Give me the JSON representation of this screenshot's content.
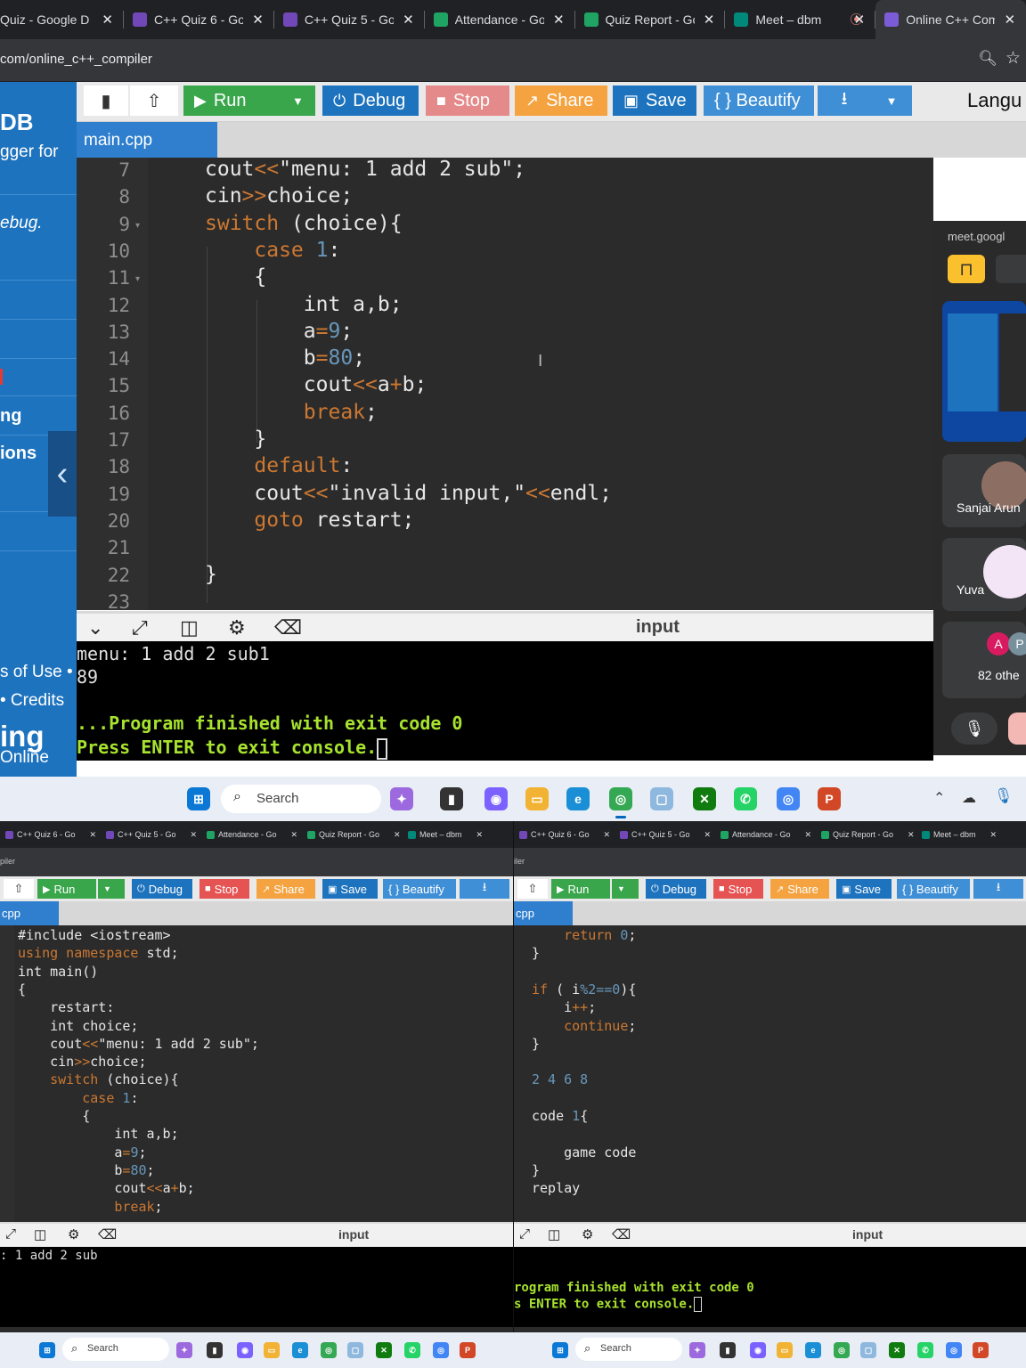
{
  "browser": {
    "tabs": [
      {
        "title": "Quiz - Google Do",
        "icon_color": "#4285f4",
        "active": false
      },
      {
        "title": "C++ Quiz 6 - Go",
        "icon_color": "#7248b9",
        "active": false
      },
      {
        "title": "C++ Quiz 5 - Go",
        "icon_color": "#7248b9",
        "active": false
      },
      {
        "title": "Attendance - Go",
        "icon_color": "#1fa463",
        "active": false
      },
      {
        "title": "Quiz Report - Go",
        "icon_color": "#1fa463",
        "active": false
      },
      {
        "title": "Meet – dbm",
        "icon_color": "#00897b",
        "active": false,
        "recording": true
      },
      {
        "title": "Online C++ Com",
        "icon_color": "#7b5cd6",
        "active": true
      }
    ],
    "close_glyph": "✕",
    "url": "com/online_c++_compiler"
  },
  "sidebar": {
    "title": "DB",
    "sub": "gger for",
    "debug": "ebug.",
    "item_ng": "ng",
    "item_ions": "ions",
    "terms": "s of Use •",
    "credits": "• Credits",
    "brand_big": "ing",
    "brand_small": "Online"
  },
  "toolbar": {
    "run": "Run",
    "debug": "Debug",
    "stop": "Stop",
    "share": "Share",
    "save": "Save",
    "beautify": "{ } Beautify",
    "language": "Langu",
    "colors": {
      "run": "#3aa64c",
      "debug": "#1e73be",
      "stop": "#e58a8a",
      "share": "#f4a340",
      "save": "#1e73be",
      "beautify": "#3f8fd6",
      "download": "#3f8fd6"
    }
  },
  "editor": {
    "file_tab": "main.cpp",
    "line_numbers": [
      "7",
      "8",
      "9",
      "10",
      "11",
      "12",
      "13",
      "14",
      "15",
      "16",
      "17",
      "18",
      "19",
      "20",
      "21",
      "22",
      "23"
    ],
    "code": [
      [
        {
          "t": "cout",
          "c": "st2"
        },
        {
          "t": "<<",
          "c": "op"
        },
        {
          "t": "\"menu: 1 add 2 sub\";",
          "c": "st2"
        }
      ],
      [
        {
          "t": "cin",
          "c": "st2"
        },
        {
          "t": ">>",
          "c": "op"
        },
        {
          "t": "choice;",
          "c": "st2"
        }
      ],
      [
        {
          "t": "switch",
          "c": "ok"
        },
        {
          "t": " (choice){",
          "c": "st2"
        }
      ],
      [
        {
          "t": "    case ",
          "c": "ok"
        },
        {
          "t": "1",
          "c": "nm"
        },
        {
          "t": ":",
          "c": "st2"
        }
      ],
      [
        {
          "t": "    {",
          "c": "st2"
        }
      ],
      [
        {
          "t": "        int a,b;",
          "c": "st2"
        }
      ],
      [
        {
          "t": "        a",
          "c": "st2"
        },
        {
          "t": "=",
          "c": "op"
        },
        {
          "t": "9",
          "c": "nm"
        },
        {
          "t": ";",
          "c": "st2"
        }
      ],
      [
        {
          "t": "        b",
          "c": "st2"
        },
        {
          "t": "=",
          "c": "op"
        },
        {
          "t": "80",
          "c": "nm"
        },
        {
          "t": ";",
          "c": "st2"
        }
      ],
      [
        {
          "t": "        cout",
          "c": "st2"
        },
        {
          "t": "<<",
          "c": "op"
        },
        {
          "t": "a",
          "c": "st2"
        },
        {
          "t": "+",
          "c": "op"
        },
        {
          "t": "b;",
          "c": "st2"
        }
      ],
      [
        {
          "t": "        break",
          "c": "ok"
        },
        {
          "t": ";",
          "c": "st2"
        }
      ],
      [
        {
          "t": "    }",
          "c": "st2"
        }
      ],
      [
        {
          "t": "    default",
          "c": "ok"
        },
        {
          "t": ":",
          "c": "st2"
        }
      ],
      [
        {
          "t": "    cout",
          "c": "st2"
        },
        {
          "t": "<<",
          "c": "op"
        },
        {
          "t": "\"invalid input,\"",
          "c": "st2"
        },
        {
          "t": "<<",
          "c": "op"
        },
        {
          "t": "endl;",
          "c": "st2"
        }
      ],
      [
        {
          "t": "    goto",
          "c": "ok"
        },
        {
          "t": " restart;",
          "c": "st2"
        }
      ],
      [
        {
          "t": "",
          "c": "st2"
        }
      ],
      [
        {
          "t": "}",
          "c": "st2"
        }
      ],
      [
        {
          "t": "",
          "c": "st2"
        }
      ]
    ]
  },
  "console": {
    "label": "input",
    "lines": [
      "menu: 1 add 2 sub1",
      "89",
      "",
      "...Program finished with exit code 0",
      "Press ENTER to exit console."
    ]
  },
  "meet": {
    "url": "meet.googl",
    "p1": "Sanjai Arun",
    "p2": "Yuva",
    "avatar_a": "A",
    "avatar_p": "P",
    "others": "82 othe"
  },
  "taskbar": {
    "search": "Search"
  },
  "mini_left": {
    "tabs": [
      "C++ Quiz 6 - Go",
      "C++ Quiz 5 - Go",
      "Attendance - Go",
      "Quiz Report - Go",
      "Meet – dbm"
    ],
    "url": "piler",
    "run": "Run",
    "debug": "Debug",
    "stop": "Stop",
    "share": "Share",
    "save": "Save",
    "beautify": "{ } Beautify",
    "file_tab": "cpp",
    "code": [
      [
        {
          "t": "#include <iostream>",
          "c": "st2"
        }
      ],
      [
        {
          "t": "using namespace",
          "c": "ok"
        },
        {
          "t": " std;",
          "c": "st2"
        }
      ],
      [
        {
          "t": "int main()",
          "c": "st2"
        }
      ],
      [
        {
          "t": "{",
          "c": "st2"
        }
      ],
      [
        {
          "t": "    restart:",
          "c": "st2"
        }
      ],
      [
        {
          "t": "    int choice;",
          "c": "st2"
        }
      ],
      [
        {
          "t": "    cout",
          "c": "st2"
        },
        {
          "t": "<<",
          "c": "op"
        },
        {
          "t": "\"menu: 1 add 2 sub\";",
          "c": "st2"
        }
      ],
      [
        {
          "t": "    cin",
          "c": "st2"
        },
        {
          "t": ">>",
          "c": "op"
        },
        {
          "t": "choice;",
          "c": "st2"
        }
      ],
      [
        {
          "t": "    switch",
          "c": "ok"
        },
        {
          "t": " (choice){",
          "c": "st2"
        }
      ],
      [
        {
          "t": "        case ",
          "c": "ok"
        },
        {
          "t": "1",
          "c": "nm"
        },
        {
          "t": ":",
          "c": "st2"
        }
      ],
      [
        {
          "t": "        {",
          "c": "st2"
        }
      ],
      [
        {
          "t": "            int a,b;",
          "c": "st2"
        }
      ],
      [
        {
          "t": "            a",
          "c": "st2"
        },
        {
          "t": "=",
          "c": "op"
        },
        {
          "t": "9",
          "c": "nm"
        },
        {
          "t": ";",
          "c": "st2"
        }
      ],
      [
        {
          "t": "            b",
          "c": "st2"
        },
        {
          "t": "=",
          "c": "op"
        },
        {
          "t": "80",
          "c": "nm"
        },
        {
          "t": ";",
          "c": "st2"
        }
      ],
      [
        {
          "t": "            cout",
          "c": "st2"
        },
        {
          "t": "<<",
          "c": "op"
        },
        {
          "t": "a",
          "c": "st2"
        },
        {
          "t": "+",
          "c": "op"
        },
        {
          "t": "b;",
          "c": "st2"
        }
      ],
      [
        {
          "t": "            break",
          "c": "ok"
        },
        {
          "t": ";",
          "c": "st2"
        }
      ]
    ],
    "console_label": "input",
    "console": [
      ": 1 add 2 sub"
    ]
  },
  "mini_right": {
    "tabs": [
      "C++ Quiz 6 - Go",
      "C++ Quiz 5 - Go",
      "Attendance - Go",
      "Quiz Report - Go",
      "Meet – dbm"
    ],
    "url": "iler",
    "run": "Run",
    "debug": "Debug",
    "stop": "Stop",
    "share": "Share",
    "save": "Save",
    "beautify": "{ } Beautify",
    "file_tab": "cpp",
    "code": [
      [
        {
          "t": "    return ",
          "c": "ok"
        },
        {
          "t": "0",
          "c": "nm"
        },
        {
          "t": ";",
          "c": "st2"
        }
      ],
      [
        {
          "t": "}",
          "c": "st2"
        }
      ],
      [
        {
          "t": "",
          "c": "st2"
        }
      ],
      [
        {
          "t": "if",
          "c": "ok"
        },
        {
          "t": " ( i",
          "c": "st2"
        },
        {
          "t": "%2==0",
          "c": "nm"
        },
        {
          "t": "){",
          "c": "st2"
        }
      ],
      [
        {
          "t": "    i",
          "c": "st2"
        },
        {
          "t": "++",
          "c": "op"
        },
        {
          "t": ";",
          "c": "st2"
        }
      ],
      [
        {
          "t": "    continue",
          "c": "ok"
        },
        {
          "t": ";",
          "c": "st2"
        }
      ],
      [
        {
          "t": "}",
          "c": "st2"
        }
      ],
      [
        {
          "t": "",
          "c": "st2"
        }
      ],
      [
        {
          "t": "2 4 6 8",
          "c": "nm"
        }
      ],
      [
        {
          "t": "",
          "c": "st2"
        }
      ],
      [
        {
          "t": "code ",
          "c": "st2"
        },
        {
          "t": "1",
          "c": "nm"
        },
        {
          "t": "{",
          "c": "st2"
        }
      ],
      [
        {
          "t": "",
          "c": "st2"
        }
      ],
      [
        {
          "t": "    game code",
          "c": "st2"
        }
      ],
      [
        {
          "t": "}",
          "c": "st2"
        }
      ],
      [
        {
          "t": "replay",
          "c": "st2"
        }
      ]
    ],
    "console_label": "input",
    "console": [
      "",
      "",
      "rogram finished with exit code 0",
      "s ENTER to exit console."
    ]
  }
}
